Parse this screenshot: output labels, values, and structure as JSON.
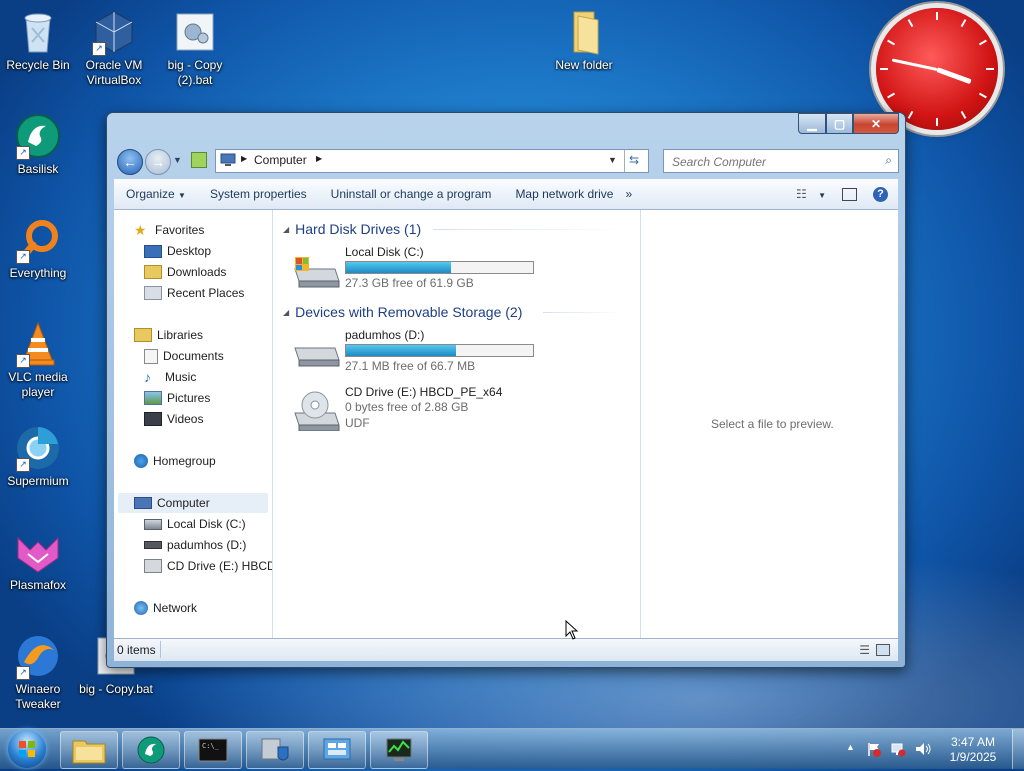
{
  "desktop": {
    "icons": [
      {
        "label": "Recycle Bin",
        "icon": "recycle-bin-icon"
      },
      {
        "label": "Oracle VM VirtualBox",
        "icon": "virtualbox-icon"
      },
      {
        "label": "big - Copy (2).bat",
        "icon": "bat-file-icon"
      },
      {
        "label": "New folder",
        "icon": "folder-icon"
      },
      {
        "label": "Basilisk",
        "icon": "basilisk-icon"
      },
      {
        "label": "Everything",
        "icon": "everything-icon"
      },
      {
        "label": "VLC media player",
        "icon": "vlc-icon"
      },
      {
        "label": "Supermium",
        "icon": "supermium-icon"
      },
      {
        "label": "Plasmafox",
        "icon": "plasmafox-icon"
      },
      {
        "label": "Winaero Tweaker",
        "icon": "winaero-icon"
      },
      {
        "label": "big - Copy.bat",
        "icon": "bat-file-icon"
      }
    ]
  },
  "explorer": {
    "breadcrumb": "Computer",
    "search_placeholder": "Search Computer",
    "toolbar": {
      "organize": "Organize",
      "system_properties": "System properties",
      "uninstall": "Uninstall or change a program",
      "map_drive": "Map network drive",
      "more": "»"
    },
    "nav": {
      "favorites": "Favorites",
      "desktop": "Desktop",
      "downloads": "Downloads",
      "recent_places": "Recent Places",
      "libraries": "Libraries",
      "documents": "Documents",
      "music": "Music",
      "pictures": "Pictures",
      "videos": "Videos",
      "homegroup": "Homegroup",
      "computer": "Computer",
      "local_disk": "Local Disk (C:)",
      "padumhos": "padumhos (D:)",
      "cd_drive": "CD Drive (E:) HBCD_",
      "network": "Network"
    },
    "groups": {
      "hdd": "Hard Disk Drives (1)",
      "removable": "Devices with Removable Storage (2)"
    },
    "drives": [
      {
        "name": "Local Disk (C:)",
        "free": "27.3 GB free of 61.9 GB",
        "used_fraction": 0.56
      },
      {
        "name": "padumhos (D:)",
        "free": "27.1 MB free of 66.7 MB",
        "used_fraction": 0.59
      },
      {
        "name": "CD Drive (E:) HBCD_PE_x64",
        "free": "0 bytes free of 2.88 GB",
        "fs": "UDF"
      }
    ],
    "preview_text": "Select a file to preview.",
    "status": "0 items"
  },
  "taskbar": {
    "time": "3:47 AM",
    "date": "1/9/2025"
  },
  "colors": {
    "accent": "#1e3f85",
    "drive_bar": "#1b8bc4",
    "clock_face": "#d11414"
  }
}
